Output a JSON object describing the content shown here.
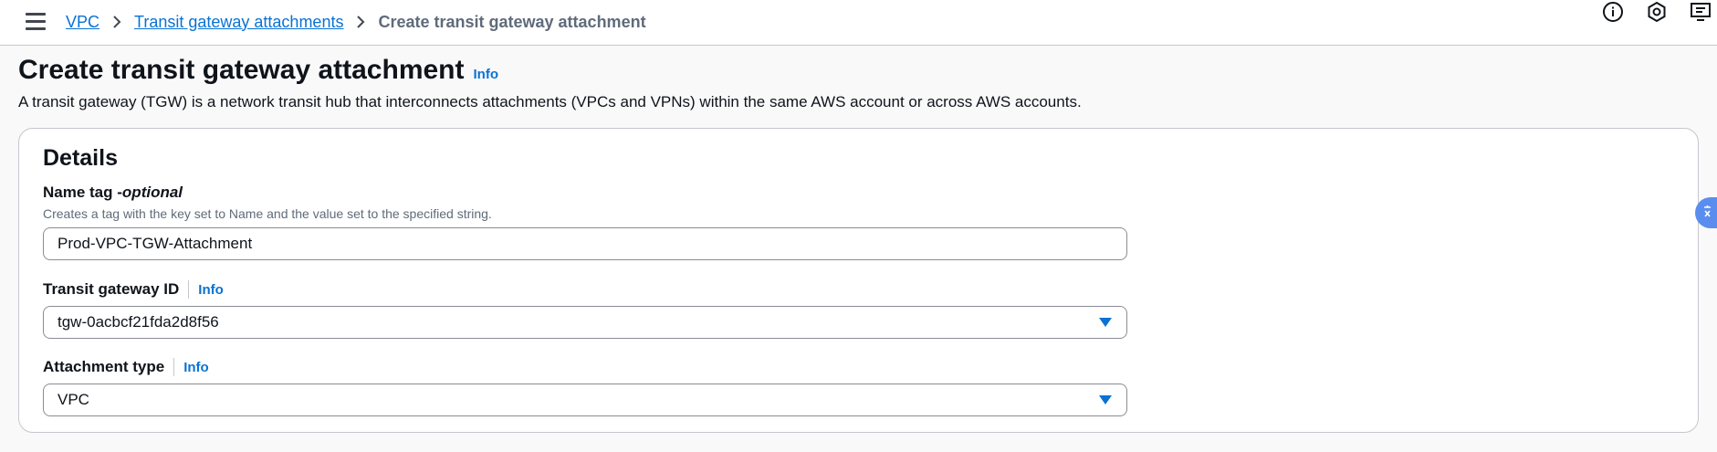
{
  "breadcrumb": {
    "items": [
      "VPC",
      "Transit gateway attachments"
    ],
    "current": "Create transit gateway attachment"
  },
  "icons": [
    "menu-icon",
    "info-circle-icon",
    "settings-hex-icon",
    "feedback-icon",
    "chevron-right-icon",
    "caret-down-icon",
    "translate-icon"
  ],
  "header": {
    "title": "Create transit gateway attachment",
    "info": "Info",
    "description": "A transit gateway (TGW) is a network transit hub that interconnects attachments (VPCs and VPNs) within the same AWS account or across AWS accounts."
  },
  "details": {
    "title": "Details",
    "name_tag": {
      "label": "Name tag - ",
      "optional": "optional",
      "description": "Creates a tag with the key set to Name and the value set to the specified string.",
      "value": "Prod-VPC-TGW-Attachment"
    },
    "transit_gateway": {
      "label": "Transit gateway ID",
      "info": "Info",
      "value": "tgw-0acbcf21fda2d8f56"
    },
    "attachment_type": {
      "label": "Attachment type",
      "info": "Info",
      "value": "VPC"
    }
  },
  "colors": {
    "link": "#0972d3",
    "text": "#0f141a",
    "muted": "#5f6b7a",
    "border": "#8c8c94"
  }
}
